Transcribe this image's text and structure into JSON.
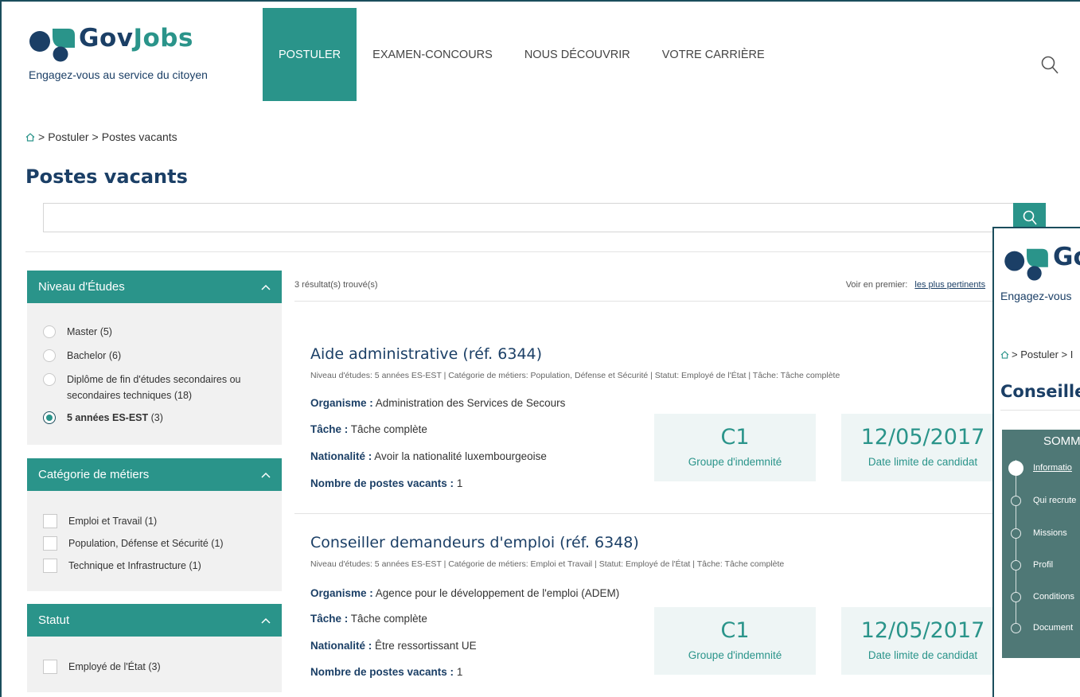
{
  "brand": {
    "name_part1": "Gov",
    "name_part2": "Jobs",
    "tagline": "Engagez-vous au service du citoyen",
    "colors": {
      "navy": "#1b3f66",
      "teal": "#2a948a"
    }
  },
  "nav": {
    "items": [
      {
        "label": "POSTULER",
        "active": true
      },
      {
        "label": "EXAMEN-CONCOURS",
        "active": false
      },
      {
        "label": "NOUS DÉCOUVRIR",
        "active": false
      },
      {
        "label": "VOTRE CARRIÈRE",
        "active": false
      }
    ],
    "search_icon": "search-icon"
  },
  "breadcrumb": {
    "home_icon": "home-icon",
    "sep": ">",
    "level1": "Postuler",
    "level2": "Postes vacants"
  },
  "page": {
    "title": "Postes vacants"
  },
  "search": {
    "value": "",
    "placeholder": "",
    "button_icon": "search-icon"
  },
  "facets": {
    "education": {
      "title": "Niveau d'Études",
      "options": [
        {
          "label": "Master",
          "count": "(5)",
          "selected": false
        },
        {
          "label": "Bachelor",
          "count": "(6)",
          "selected": false
        },
        {
          "label": "Diplôme de fin d'études secondaires ou secondaires techniques",
          "count": "(18)",
          "selected": false
        },
        {
          "label": "5 années ES-EST",
          "count": "(3)",
          "selected": true
        }
      ]
    },
    "category": {
      "title": "Catégorie de métiers",
      "options": [
        {
          "label": "Emploi et Travail",
          "count": "(1)"
        },
        {
          "label": "Population, Défense et Sécurité",
          "count": "(1)"
        },
        {
          "label": "Technique et Infrastructure",
          "count": "(1)"
        }
      ]
    },
    "status": {
      "title": "Statut",
      "options": [
        {
          "label": "Employé de l'État",
          "count": "(3)"
        }
      ]
    }
  },
  "results": {
    "count_text": "3 résultat(s) trouvé(s)",
    "sort_label": "Voir en premier:",
    "sort_value": "les plus pertinents",
    "sort_divider": "|"
  },
  "jobs": [
    {
      "title": "Aide administrative (réf. 6344)",
      "meta": "Niveau d'études: 5 années ES-EST  |  Catégorie de métiers: Population, Défense et Sécurité  |  Statut: Employé de l'État  |  Tâche: Tâche complète",
      "organisme_label": "Organisme :",
      "organisme": "Administration des Services de Secours",
      "tache_label": "Tâche :",
      "tache": "Tâche complète",
      "nationalite_label": "Nationalité :",
      "nationalite": "Avoir la nationalité luxembourgeoise",
      "postes_label": "Nombre de postes vacants :",
      "postes": "1",
      "group_value": "C1",
      "group_label": "Groupe d'indemnité",
      "deadline_value": "12/05/2017",
      "deadline_label": "Date limite de candidat"
    },
    {
      "title": "Conseiller demandeurs d'emploi (réf. 6348)",
      "meta": "Niveau d'études: 5 années ES-EST  |  Catégorie de métiers: Emploi et Travail  |  Statut: Employé de l'État  |  Tâche: Tâche complète",
      "organisme_label": "Organisme :",
      "organisme": "Agence pour le développement de l'emploi (ADEM)",
      "tache_label": "Tâche :",
      "tache": "Tâche complète",
      "nationalite_label": "Nationalité :",
      "nationalite": "Être ressortissant UE",
      "postes_label": "Nombre de postes vacants :",
      "postes": "1",
      "group_value": "C1",
      "group_label": "Groupe d'indemnité",
      "deadline_value": "12/05/2017",
      "deadline_label": "Date limite de candidat"
    }
  ],
  "overlay": {
    "logo_text": "Go",
    "tagline": "Engagez-vous",
    "breadcrumb": "> Postuler > I",
    "title": "Conseille",
    "summary_title": "SOMM",
    "summary_items": [
      {
        "label": "Informatio",
        "active": true
      },
      {
        "label": "Qui recrute",
        "active": false
      },
      {
        "label": "Missions",
        "active": false
      },
      {
        "label": "Profil",
        "active": false
      },
      {
        "label": "Conditions",
        "active": false
      },
      {
        "label": "Document",
        "active": false
      }
    ]
  }
}
